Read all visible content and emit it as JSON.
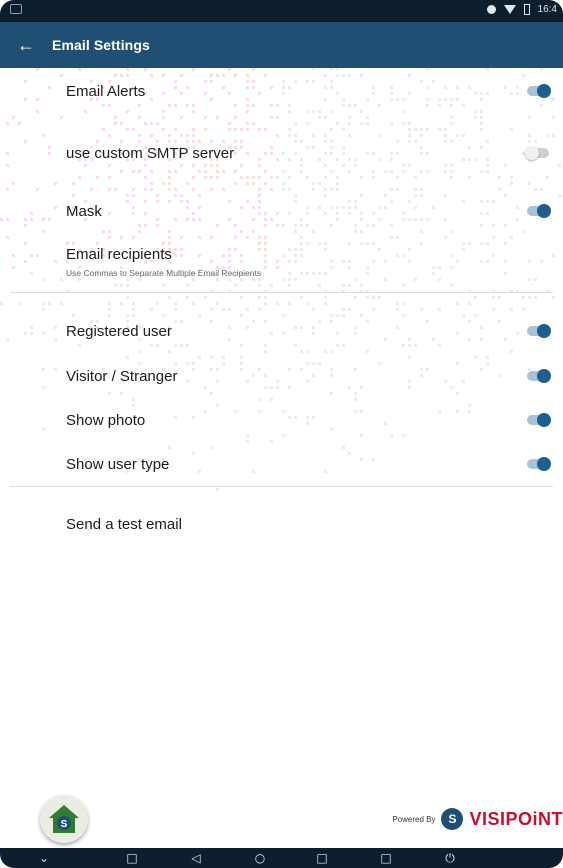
{
  "status_bar": {
    "time": "16:4"
  },
  "app_bar": {
    "title": "Email Settings",
    "back_icon": "arrow-left-icon"
  },
  "settings": {
    "email_alerts": {
      "label": "Email Alerts",
      "enabled": true
    },
    "custom_smtp": {
      "label": "use custom SMTP server",
      "enabled": false
    },
    "mask": {
      "label": "Mask",
      "enabled": true
    },
    "email_recipients": {
      "label": "Email recipients",
      "hint": "Use Commas to Separate Multiple Email Recipients"
    },
    "registered_user": {
      "label": "Registered user",
      "enabled": true
    },
    "visitor_stranger": {
      "label": "Visitor / Stranger",
      "enabled": true
    },
    "show_photo": {
      "label": "Show photo",
      "enabled": true
    },
    "show_user_type": {
      "label": "Show user type",
      "enabled": true
    },
    "send_test_email": {
      "label": "Send a test email"
    }
  },
  "footer": {
    "powered_by": "Powered By",
    "brand": "VISIPOiNT",
    "home_icon": "home-icon"
  },
  "colors": {
    "primary": "#1f4f73",
    "toggle_on": "#1f5f8f",
    "brand_red": "#c8102e"
  }
}
